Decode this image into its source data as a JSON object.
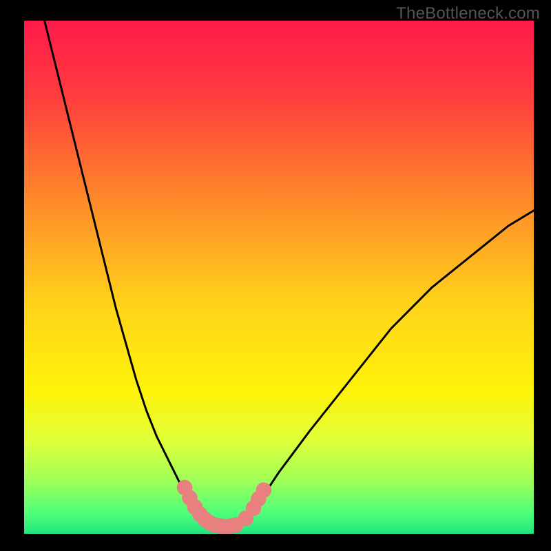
{
  "watermark": "TheBottleneck.com",
  "chart_data": {
    "type": "line",
    "title": "",
    "xlabel": "",
    "ylabel": "",
    "xlim": [
      0,
      100
    ],
    "ylim": [
      0,
      100
    ],
    "grid": false,
    "legend": false,
    "gradient_stops": [
      {
        "offset": 0.0,
        "color": "#ff1a4a"
      },
      {
        "offset": 0.15,
        "color": "#ff3e3e"
      },
      {
        "offset": 0.35,
        "color": "#ff8a2a"
      },
      {
        "offset": 0.55,
        "color": "#ffd21a"
      },
      {
        "offset": 0.72,
        "color": "#fff30a"
      },
      {
        "offset": 0.82,
        "color": "#dfff3a"
      },
      {
        "offset": 0.9,
        "color": "#9bff5a"
      },
      {
        "offset": 0.96,
        "color": "#4fff7a"
      },
      {
        "offset": 1.0,
        "color": "#22e67e"
      }
    ],
    "series": [
      {
        "name": "left-curve",
        "stroke": "#000000",
        "x": [
          4,
          6,
          8,
          10,
          12,
          14,
          16,
          18,
          20,
          22,
          24,
          26,
          27,
          28,
          29,
          30,
          31,
          32,
          33,
          34,
          35,
          36
        ],
        "y": [
          100,
          92,
          84,
          76,
          68,
          60,
          52,
          44,
          37,
          30,
          24,
          19,
          17,
          15,
          13,
          11,
          9,
          7.5,
          6,
          4.5,
          3,
          2
        ]
      },
      {
        "name": "right-curve",
        "stroke": "#000000",
        "x": [
          42,
          44,
          46,
          48,
          50,
          53,
          56,
          60,
          64,
          68,
          72,
          76,
          80,
          85,
          90,
          95,
          100
        ],
        "y": [
          2,
          4,
          6.5,
          9,
          12,
          16,
          20,
          25,
          30,
          35,
          40,
          44,
          48,
          52,
          56,
          60,
          63
        ]
      },
      {
        "name": "floor",
        "stroke": "#e98080",
        "x": [
          33,
          34,
          35,
          36,
          37,
          38,
          39,
          40,
          41,
          42,
          43,
          44,
          45,
          46
        ],
        "y": [
          6,
          4.5,
          3,
          2.2,
          1.7,
          1.4,
          1.3,
          1.3,
          1.4,
          1.8,
          2.5,
          3.5,
          5,
          7
        ]
      }
    ],
    "markers": [
      {
        "x": 31.5,
        "y": 9.0,
        "r": 1.1,
        "color": "#e98080"
      },
      {
        "x": 32.5,
        "y": 7.0,
        "r": 1.1,
        "color": "#e98080"
      },
      {
        "x": 33.5,
        "y": 5.2,
        "r": 1.1,
        "color": "#e98080"
      },
      {
        "x": 34.5,
        "y": 3.8,
        "r": 1.1,
        "color": "#e98080"
      },
      {
        "x": 35.5,
        "y": 2.8,
        "r": 1.1,
        "color": "#e98080"
      },
      {
        "x": 36.5,
        "y": 2.1,
        "r": 1.1,
        "color": "#e98080"
      },
      {
        "x": 37.5,
        "y": 1.7,
        "r": 1.1,
        "color": "#e98080"
      },
      {
        "x": 38.5,
        "y": 1.5,
        "r": 1.1,
        "color": "#e98080"
      },
      {
        "x": 39.5,
        "y": 1.4,
        "r": 1.1,
        "color": "#e98080"
      },
      {
        "x": 40.5,
        "y": 1.5,
        "r": 1.1,
        "color": "#e98080"
      },
      {
        "x": 41.5,
        "y": 1.7,
        "r": 1.1,
        "color": "#e98080"
      },
      {
        "x": 43.5,
        "y": 3.0,
        "r": 1.1,
        "color": "#e98080"
      },
      {
        "x": 45.0,
        "y": 5.0,
        "r": 1.1,
        "color": "#e98080"
      },
      {
        "x": 46.0,
        "y": 6.8,
        "r": 1.1,
        "color": "#e98080"
      },
      {
        "x": 47.0,
        "y": 8.5,
        "r": 1.1,
        "color": "#e98080"
      }
    ]
  }
}
